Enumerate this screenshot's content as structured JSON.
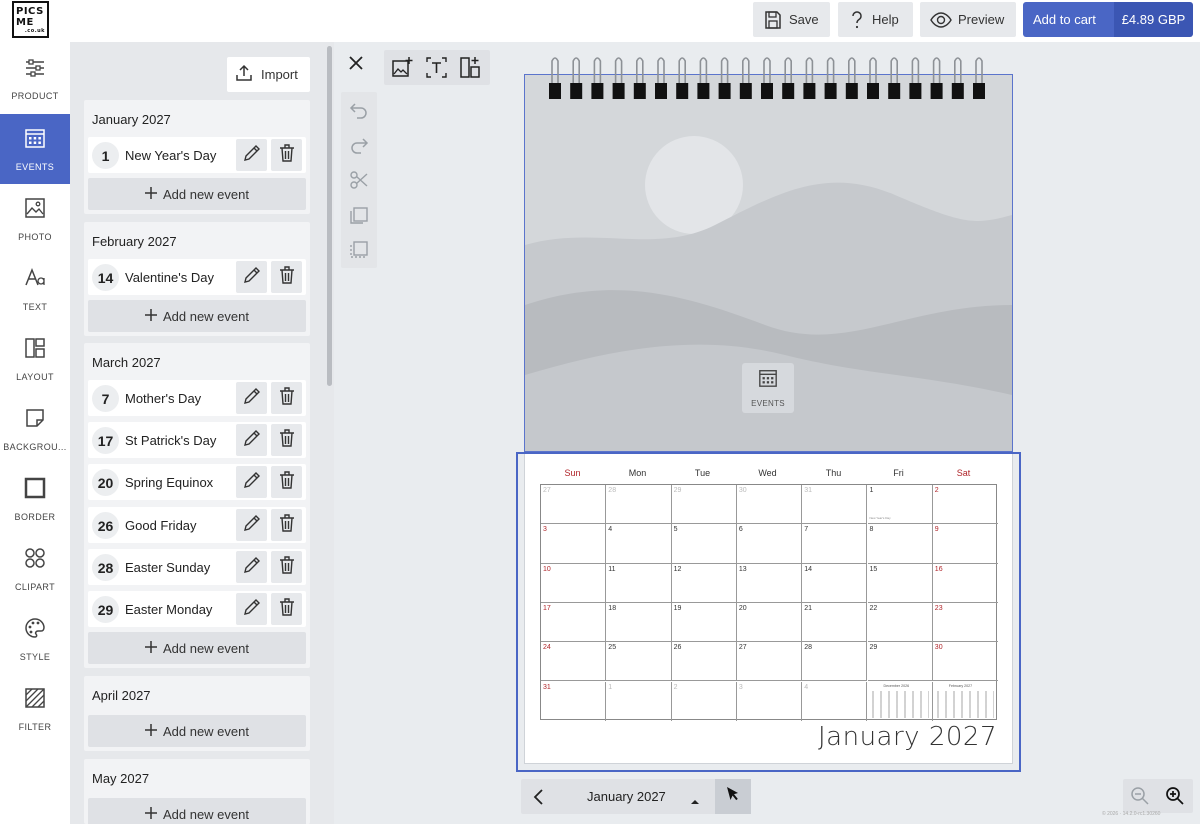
{
  "topbar": {
    "logo_line1": "PICS",
    "logo_line2": "ME",
    "logo_small": ".co.uk",
    "save_label": "Save",
    "help_label": "Help",
    "preview_label": "Preview",
    "add_to_cart_label": "Add to cart",
    "price": "£4.89 GBP"
  },
  "nav": [
    {
      "label": "PRODUCT",
      "icon": "sliders-icon"
    },
    {
      "label": "EVENTS",
      "icon": "calendar-icon"
    },
    {
      "label": "PHOTO",
      "icon": "image-icon"
    },
    {
      "label": "TEXT",
      "icon": "text-icon"
    },
    {
      "label": "LAYOUT",
      "icon": "layout-icon"
    },
    {
      "label": "BACKGROU...",
      "icon": "background-icon"
    },
    {
      "label": "BORDER",
      "icon": "border-icon"
    },
    {
      "label": "CLIPART",
      "icon": "clipart-icon"
    },
    {
      "label": "STYLE",
      "icon": "palette-icon"
    },
    {
      "label": "FILTER",
      "icon": "filter-icon"
    }
  ],
  "events_panel": {
    "import_label": "Import",
    "add_event_label": "Add new event",
    "months": [
      {
        "title": "January 2027",
        "events": [
          {
            "day": "1",
            "name": "New Year's Day"
          }
        ]
      },
      {
        "title": "February 2027",
        "events": [
          {
            "day": "14",
            "name": "Valentine's Day"
          }
        ]
      },
      {
        "title": "March 2027",
        "events": [
          {
            "day": "7",
            "name": "Mother's Day"
          },
          {
            "day": "17",
            "name": "St Patrick's Day"
          },
          {
            "day": "20",
            "name": "Spring Equinox"
          },
          {
            "day": "26",
            "name": "Good Friday"
          },
          {
            "day": "28",
            "name": "Easter Sunday"
          },
          {
            "day": "29",
            "name": "Easter Monday"
          }
        ]
      },
      {
        "title": "April 2027",
        "events": []
      },
      {
        "title": "May 2027",
        "events": []
      }
    ]
  },
  "canvas": {
    "events_badge_label": "EVENTS",
    "weekdays": [
      "Sun",
      "Mon",
      "Tue",
      "Wed",
      "Thu",
      "Fri",
      "Sat"
    ],
    "weeks": [
      [
        "27",
        "28",
        "29",
        "30",
        "31",
        "1",
        "2"
      ],
      [
        "3",
        "4",
        "5",
        "6",
        "7",
        "8",
        "9"
      ],
      [
        "10",
        "11",
        "12",
        "13",
        "14",
        "15",
        "16"
      ],
      [
        "17",
        "18",
        "19",
        "20",
        "21",
        "22",
        "23"
      ],
      [
        "24",
        "25",
        "26",
        "27",
        "28",
        "29",
        "30"
      ],
      [
        "31",
        "1",
        "2",
        "3",
        "4",
        "",
        ""
      ]
    ],
    "first_day_note": "New Year's Day",
    "mini_prev_title": "December 2026",
    "mini_next_title": "February 2027",
    "calendar_title": "January 2027"
  },
  "bottom_nav": {
    "current_month": "January 2027"
  },
  "version_text": "© 2026 · 14.2.0-rc1.30260"
}
